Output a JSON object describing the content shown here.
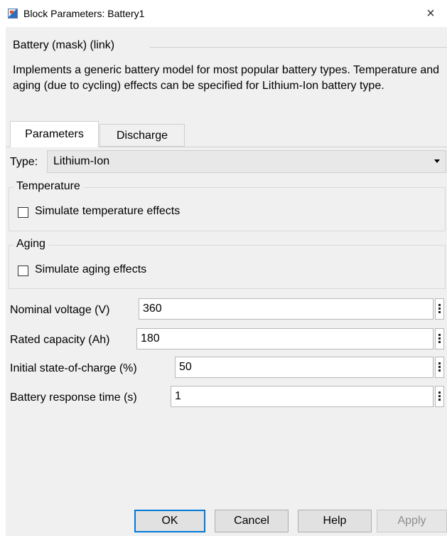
{
  "window": {
    "title": "Block Parameters: Battery1",
    "close_glyph": "×"
  },
  "mask": {
    "header": "Battery (mask) (link)",
    "description": "Implements a generic battery model for most popular battery types. Temperature and aging (due to cycling) effects can be specified for Lithium-Ion battery type."
  },
  "tabs": [
    {
      "label": "Parameters",
      "active": true
    },
    {
      "label": "Discharge",
      "active": false
    }
  ],
  "type": {
    "label": "Type:",
    "value": "Lithium-Ion"
  },
  "temperature": {
    "legend": "Temperature",
    "checkbox_label": "Simulate temperature effects",
    "checked": false
  },
  "aging": {
    "legend": "Aging",
    "checkbox_label": "Simulate aging effects",
    "checked": false
  },
  "params": [
    {
      "label": "Nominal voltage (V)",
      "value": "360"
    },
    {
      "label": "Rated capacity (Ah)",
      "value": "180"
    },
    {
      "label": "Initial state-of-charge (%)",
      "value": "50"
    },
    {
      "label": "Battery response time (s)",
      "value": "1"
    }
  ],
  "buttons": {
    "ok": "OK",
    "cancel": "Cancel",
    "help": "Help",
    "apply": "Apply"
  },
  "colors": {
    "dialog_bg": "#f0f0f0",
    "default_button_border": "#0078d7",
    "disabled_text": "#8d8d8d"
  }
}
